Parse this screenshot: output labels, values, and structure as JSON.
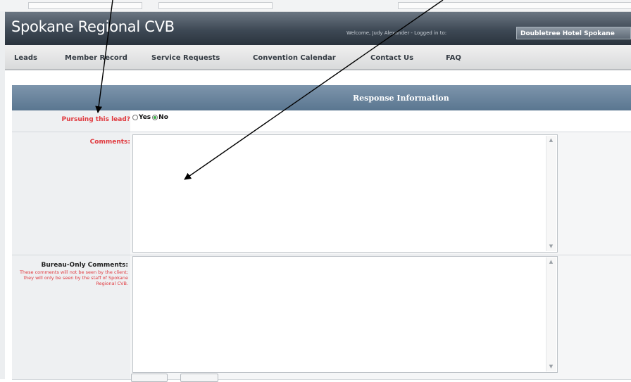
{
  "header": {
    "site_title": "Spokane Regional CVB",
    "welcome_prefix": "Welcome, Judy Alexander - Logged in to:",
    "hotel_name": "Doubletree Hotel Spokane"
  },
  "nav": {
    "items": [
      "Leads",
      "Member Record",
      "Service Requests",
      "Convention Calendar",
      "Contact Us",
      "FAQ"
    ]
  },
  "section": {
    "title": "Response Information"
  },
  "form": {
    "pursuing_label": "Pursuing this lead?",
    "pursuing_options": [
      "Yes",
      "No"
    ],
    "pursuing_selected": "No",
    "comments_label": "Comments:",
    "comments_value": "",
    "bureau_label": "Bureau-Only Comments:",
    "bureau_note": "These comments will not be seen by the client; they will only be seen by the staff of Spokane Regional CVB.",
    "bureau_value": ""
  },
  "colors": {
    "header_dark": "#2a333d",
    "section_blue": "#5a7690",
    "label_red": "#e0393e",
    "radio_selected": "#3fae49"
  },
  "annotations": {
    "arrows": 2
  }
}
